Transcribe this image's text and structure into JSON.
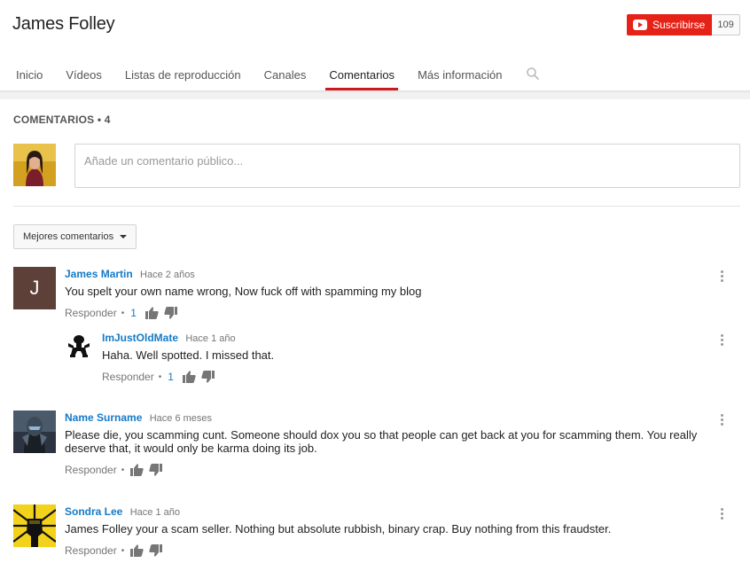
{
  "channel": {
    "title": "James Folley",
    "subscribe_label": "Suscribirse",
    "subscriber_count": "109"
  },
  "tabs": [
    {
      "label": "Inicio"
    },
    {
      "label": "Vídeos"
    },
    {
      "label": "Listas de reproducción"
    },
    {
      "label": "Canales"
    },
    {
      "label": "Comentarios",
      "active": true
    },
    {
      "label": "Más información"
    }
  ],
  "comments_section": {
    "heading": "COMENTARIOS • 4",
    "input_placeholder": "Añade un comentario público...",
    "sort_label": "Mejores comentarios"
  },
  "comments": [
    {
      "author": "James Martin",
      "time": "Hace 2 años",
      "text": "You spelt your own name wrong, Now fuck off with spamming my blog",
      "reply_label": "Responder",
      "likes": "1",
      "avatar_letter": "J",
      "avatar_color": "#5d4037"
    },
    {
      "author": "ImJustOldMate",
      "time": "Hace 1 año",
      "text": "Haha. Well spotted. I missed that.",
      "reply_label": "Responder",
      "likes": "1"
    },
    {
      "author": "Name Surname",
      "time": "Hace 6 meses",
      "text": "Please die, you scamming cunt. Someone should dox you so that people can get back at you for scamming them. You really deserve that, it would only be karma doing its job.",
      "reply_label": "Responder"
    },
    {
      "author": "Sondra Lee",
      "time": "Hace 1 año",
      "text": "James Folley your a scam seller. Nothing but absolute rubbish, binary crap. Buy nothing from this fraudster.",
      "reply_label": "Responder"
    }
  ],
  "colors": {
    "accent_red": "#e62117",
    "link_blue": "#167ac6",
    "active_tab_underline": "#cc181e"
  },
  "icons": [
    "youtube-logo-icon",
    "search-icon",
    "thumbs-up-icon",
    "thumbs-down-icon",
    "more-vert-icon",
    "chevron-down-icon"
  ]
}
